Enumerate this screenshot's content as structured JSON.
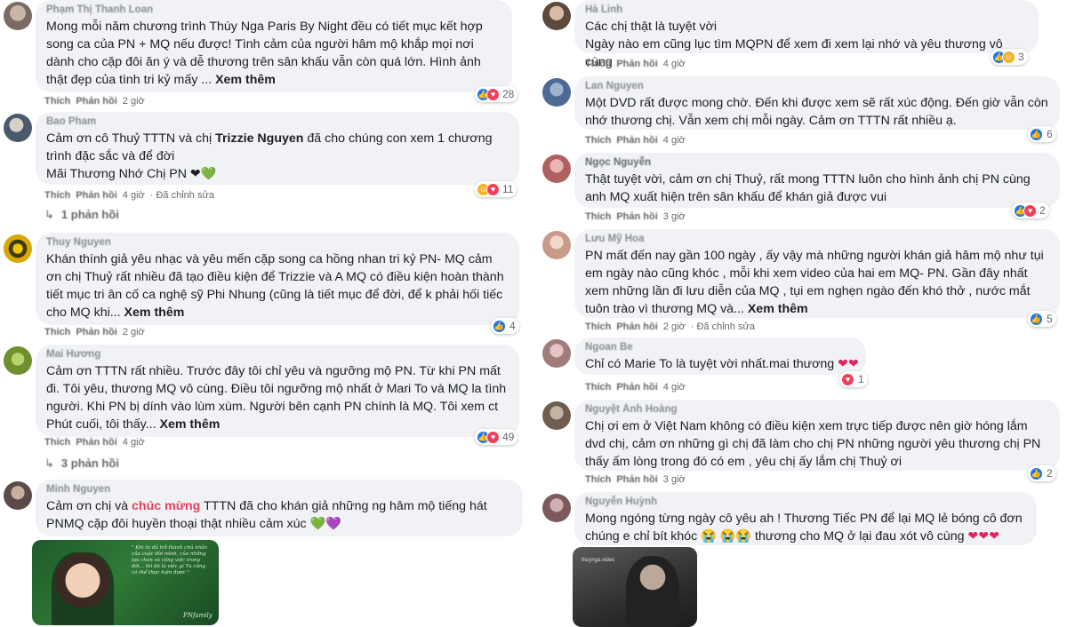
{
  "left": {
    "c1": {
      "author": "Phạm Thị Thanh Loan",
      "text": "Mong mỗi năm chương trình Thúy Nga Paris By Night đều có tiết mục kết hợp song ca của PN + MQ nếu được! Tình cảm của người hâm mộ khắp mọi nơi dành cho cặp đôi ăn ý và dễ thương trên sân khấu vẫn còn quá lớn. Hình ảnh thật đẹp của tình tri kỷ mấy ...",
      "see_more": "Xem thêm",
      "like": "Thích",
      "reply": "Phản hồi",
      "time": "2 giờ",
      "reactions": "28"
    },
    "c2": {
      "author": "Bao Pham",
      "text_a": "Cảm ơn cô Thuỷ TTTN và chị ",
      "mention": "Trizzie Nguyen",
      "text_b": " đã cho chúng con xem 1 chương trình đặc sắc và để đời",
      "line2": "Mãi Thương Nhớ Chị PN",
      "emoji": "❤💚",
      "like": "Thích",
      "reply": "Phản hồi",
      "time": "4 giờ",
      "edited": "Đã chỉnh sửa",
      "reactions": "11",
      "replies": "1 phản hồi"
    },
    "c3": {
      "author": "Thuy Nguyen",
      "text": "Khán thính giả yêu nhạc và yêu mến cặp song ca hồng nhan tri kỷ PN- MQ cảm ơn chị Thuỷ rất nhiều đã tạo điều kiện để Trizzie và A MQ có điều kiện hoàn thành tiết mục tri ân cố ca nghệ sỹ Phi Nhung (cũng là tiết mục để đời, để k phải hối tiếc cho MQ khi...",
      "see_more": "Xem thêm",
      "like": "Thích",
      "reply": "Phản hồi",
      "time": "2 giờ",
      "reactions": "4"
    },
    "c4": {
      "author": "Mai Hương",
      "text": "Cảm ơn TTTN rất nhiều. Trước đây tôi chỉ yêu và ngưỡng mộ PN. Từ khi PN mất đi. Tôi yêu, thương MQ vô cùng. Điều tôi ngưỡng mộ nhất ở Mari To và MQ la tình người. Khi PN bị dính vào lùm xùm. Người bên cạnh PN chính là MQ. Tôi xem ct Phút cuối, tôi thấy...",
      "see_more": "Xem thêm",
      "like": "Thích",
      "reply": "Phản hồi",
      "time": "4 giờ",
      "reactions": "49",
      "replies": "3 phản hồi"
    },
    "c5": {
      "author": "Minh Nguyen",
      "text_a": "Cảm ơn chị và ",
      "highlight": "chúc mừng",
      "text_b": " TTTN đã cho khán giả những ng hâm mộ tiếng hát PNMQ cặp đôi huyền thoại thật nhiều cảm xúc ",
      "emoji": "💚💜",
      "image_quote": "\" Khi tu đã trở thành chủ nhân của cuộc đời mình, của những lựa chọn và công việc trong đời... thì dù là việc gì Tu cũng có thể thực hiện được \"",
      "image_sign": "PNfamily"
    }
  },
  "right": {
    "c1": {
      "author": "Hà Linh",
      "text1": "Các chị thật là tuyệt vời",
      "text2": "Ngày nào em cũng lục tìm MQPN để xem đi xem lại nhớ và yêu thương vô cùng",
      "like": "Thích",
      "reply": "Phản hồi",
      "time": "4 giờ",
      "reactions": "3"
    },
    "c2": {
      "author": "Lan Nguyen",
      "text": "Một DVD rất được mong chờ. Đến khi được xem sẽ rất xúc động. Đến giờ vẫn còn nhớ thương chị. Vẫn xem chị mỗi ngày. Cảm ơn TTTN rất nhiều ạ.",
      "like": "Thích",
      "reply": "Phản hồi",
      "time": "4 giờ",
      "reactions": "6"
    },
    "c3": {
      "author": "Ngọc Nguyễn",
      "text": "Thật tuyệt vời, cảm ơn chị Thuỷ, rất mong TTTN luôn cho hình ảnh chị PN cùng anh MQ xuất hiện trên sân khấu để khán giả được vui",
      "like": "Thích",
      "reply": "Phản hồi",
      "time": "3 giờ",
      "reactions": "2"
    },
    "c4": {
      "author": "Lưu Mỹ Hoa",
      "text": "PN mất đến nay gần 100 ngày , ấy vậy mà những người khán giả hâm mộ như tụi em ngày nào cũng khóc , mỗi khi xem video của hai em MQ- PN. Gần đây nhất xem những lần đi lưu diễn của MQ , tụi em nghẹn ngào đến khó thở , nước mắt tuôn trào vì thương MQ và...",
      "see_more": "Xem thêm",
      "like": "Thích",
      "reply": "Phản hồi",
      "time": "2 giờ",
      "edited": "Đã chỉnh sửa",
      "reactions": "5"
    },
    "c5": {
      "author": "Ngoan Be",
      "text": "Chỉ có Marie To là tuyệt vời nhất.mai thương ",
      "emoji": "❤❤",
      "like": "Thích",
      "reply": "Phản hồi",
      "time": "4 giờ",
      "reactions": "1"
    },
    "c6": {
      "author": "Nguyệt Ánh Hoàng",
      "text": "Chị ơi em ở Việt Nam không có điều kiện xem trực tiếp được nên giờ hóng lắm dvd chị, cảm ơn những gì chị đã làm cho chị PN những người yêu thương chị PN thấy ấm lòng trong đó có em , yêu chị ấy lắm chị Thuỷ ơi",
      "like": "Thích",
      "reply": "Phản hồi",
      "time": "3 giờ",
      "reactions": "2"
    },
    "c7": {
      "author": "Nguyễn Huỳnh",
      "text_a": "Mong ngóng từng ngày cô yêu ah ! Thương Tiếc PN để lại MQ lẻ bóng cô đơn chúng e chỉ bít khóc ",
      "cry1": "😭",
      "cry2": "😭😭",
      "text_b": " thương cho MQ ở lại đau xót vô cùng ",
      "hearts": "❤❤❤",
      "image_watermark": "thuynga.video"
    }
  },
  "colors": {
    "bubble": "#f0f2f5",
    "like": "#1877f2",
    "love": "#f33e58",
    "care": "#f7b125",
    "meta": "#65676b"
  }
}
